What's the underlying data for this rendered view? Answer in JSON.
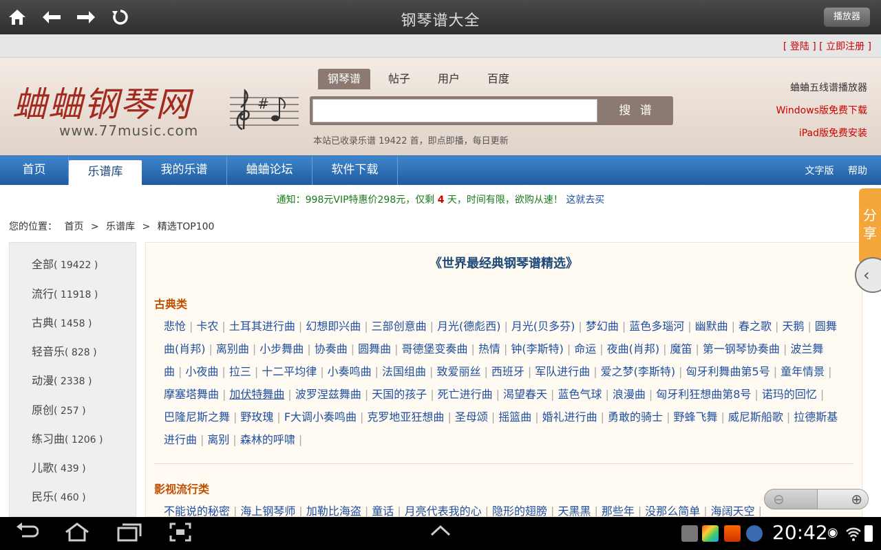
{
  "app": {
    "title": "钢琴谱大全",
    "player_label": "播放器"
  },
  "login": {
    "login": "登陆",
    "register": "立即注册"
  },
  "header": {
    "logo_text": "蛐蛐钢琴网",
    "logo_url": "www.77music.com",
    "tabs": [
      "钢琴谱",
      "帖子",
      "用户",
      "百度"
    ],
    "search_placeholder": "",
    "search_button": "搜 谱",
    "collect_info": "本站已收录乐谱 19422 首，即点即播，每日更新",
    "right_links": [
      "蛐蛐五线谱播放器",
      "Windows版免费下载",
      "iPad版免费安装"
    ]
  },
  "nav": {
    "items": [
      "首页",
      "乐谱库",
      "我的乐谱",
      "蛐蛐论坛",
      "软件下载"
    ],
    "right": [
      "文字版",
      "帮助"
    ]
  },
  "notice": {
    "prefix": "通知：998元VIP特惠价298元，仅剩 ",
    "days": "4",
    "suffix": " 天，时间有限，欲购从速！",
    "buy_link": "这就去买"
  },
  "breadcrumb": [
    "您的位置：",
    "首页",
    ">",
    "乐谱库",
    ">",
    "精选TOP100"
  ],
  "sidebar": {
    "categories": [
      {
        "name": "全部",
        "count": "( 19422 )"
      },
      {
        "name": "流行",
        "count": "( 11918 )"
      },
      {
        "name": "古典",
        "count": "( 1458 )"
      },
      {
        "name": "轻音乐",
        "count": "( 828 )"
      },
      {
        "name": "动漫",
        "count": "( 2338 )"
      },
      {
        "name": "原创",
        "count": "( 257 )"
      },
      {
        "name": "练习曲",
        "count": "( 1206 )"
      },
      {
        "name": "儿歌",
        "count": "( 439 )"
      },
      {
        "name": "民乐",
        "count": "( 460 )"
      }
    ]
  },
  "main": {
    "heading": "《世界最经典钢琴谱精选》",
    "sections": [
      {
        "title": "古典类",
        "links": [
          "悲怆",
          "卡农",
          "土耳其进行曲",
          "幻想即兴曲",
          "三部创意曲",
          "月光(德彪西)",
          "月光(贝多芬)",
          "梦幻曲",
          "蓝色多瑙河",
          "幽默曲",
          "春之歌",
          "天鹅",
          "圆舞曲(肖邦)",
          "离别曲",
          "小步舞曲",
          "协奏曲",
          "圆舞曲",
          "哥德堡变奏曲",
          "热情",
          "钟(李斯特)",
          "命运",
          "夜曲(肖邦)",
          "魔笛",
          "第一钢琴协奏曲",
          "波兰舞曲",
          "小夜曲",
          "拉三",
          "十二平均律",
          "小奏鸣曲",
          "法国组曲",
          "致爱丽丝",
          "西班牙",
          "军队进行曲",
          "爱之梦(李斯特)",
          "匈牙利舞曲第5号",
          "童年情景",
          "摩塞塔舞曲",
          "加伏特舞曲",
          "波罗涅兹舞曲",
          "天国的孩子",
          "死亡进行曲",
          "渴望春天",
          "蓝色气球",
          "浪漫曲",
          "匈牙利狂想曲第8号",
          "诺玛的回忆",
          "巴隆尼斯之舞",
          "野玫瑰",
          "F大调小奏鸣曲",
          "克罗地亚狂想曲",
          "圣母颂",
          "摇篮曲",
          "婚礼进行曲",
          "勇敢的骑士",
          "野蜂飞舞",
          "威尼斯船歌",
          "拉德斯基进行曲",
          "离别",
          "森林的呼啸"
        ]
      },
      {
        "title": "影视流行类",
        "links": [
          "不能说的秘密",
          "海上钢琴师",
          "加勒比海盗",
          "童话",
          "月亮代表我的心",
          "隐形的翅膀",
          "天黑黑",
          "那些年",
          "没那么简单",
          "海阔天空"
        ]
      }
    ]
  },
  "share": {
    "label": "分享"
  },
  "statusbar": {
    "time": "20:42"
  }
}
